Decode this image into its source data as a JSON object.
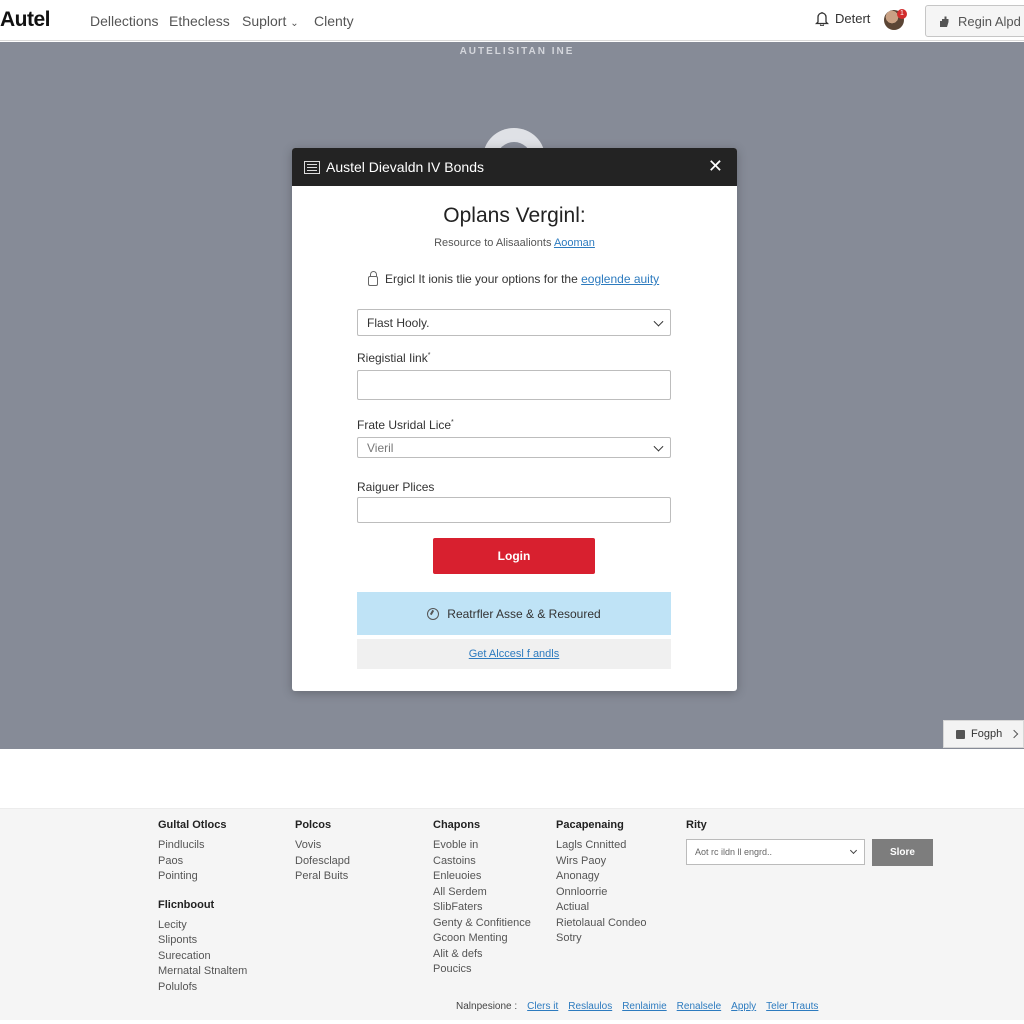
{
  "nav": {
    "logo": "Autel",
    "links": [
      "Dellections",
      "Ethecless",
      "Suplort",
      "Clenty"
    ],
    "user_label": "Detert",
    "avatar_badge": "1",
    "login_label": "Regin Alpd"
  },
  "backdrop": {
    "caption": "AUTELISITAN INE"
  },
  "modal": {
    "header_title": "Austel Dievaldn IV Bonds",
    "close_symbol": "✕",
    "title": "Oplans Verginl:",
    "subtitle_text": "Resource to Alisaalionts",
    "subtitle_link": "Aooman",
    "info_text": "Ergicl It ionis tlie your options for the",
    "info_link": "eoglende auity",
    "select1_value": "Flast Hooly.",
    "field2_label": "Riegistial Iink",
    "field2_required": "*",
    "field3_label": "Frate Usridal Lice",
    "field3_required": "*",
    "select3_value": "Vieril",
    "field4_label": "Raiguer Plices",
    "login_button": "Login",
    "resource_text": "Reatrfler Asse & & Resoured",
    "access_link": "Get Alccesl f andls"
  },
  "side_tab": {
    "label": "Fogph"
  },
  "footer": {
    "columns": [
      {
        "title": "Gultal Otlocs",
        "items": [
          "Pindlucils",
          "Paos",
          "Pointing"
        ],
        "title2": "Flicnboout",
        "items2": [
          "Lecity",
          "Sliponts",
          "Surecation",
          "Mernatal Stnaltem",
          "Polulofs"
        ]
      },
      {
        "title": "Polcos",
        "items": [
          "Vovis",
          "Dofesclapd",
          "Peral Buits"
        ]
      },
      {
        "title": "Chapons",
        "items": [
          "Evoble in",
          "Castoins",
          "Enleuoies",
          "All Serdem",
          "SlibFaters",
          "Genty & Confitience",
          "Gcoon Menting",
          "Alit & defs",
          "Poucics"
        ]
      },
      {
        "title": "Pacapenaing",
        "items": [
          "Lagls Cnnitted",
          "Wirs Paoy",
          "Anonagy",
          "Onnloorrie",
          "Actiual",
          "Rietolaual Condeo",
          "Sotry"
        ]
      },
      {
        "title": "Rity",
        "items": []
      }
    ],
    "select_placeholder": "Aot rc ildn ll engrd..",
    "store_button": "Slore",
    "bottom_label": "Nalnpesione :",
    "bottom_links": [
      "Clers it",
      "Reslaulos",
      "Renlaimie",
      "Renalsele",
      "Apply",
      "Teler Trauts"
    ]
  }
}
